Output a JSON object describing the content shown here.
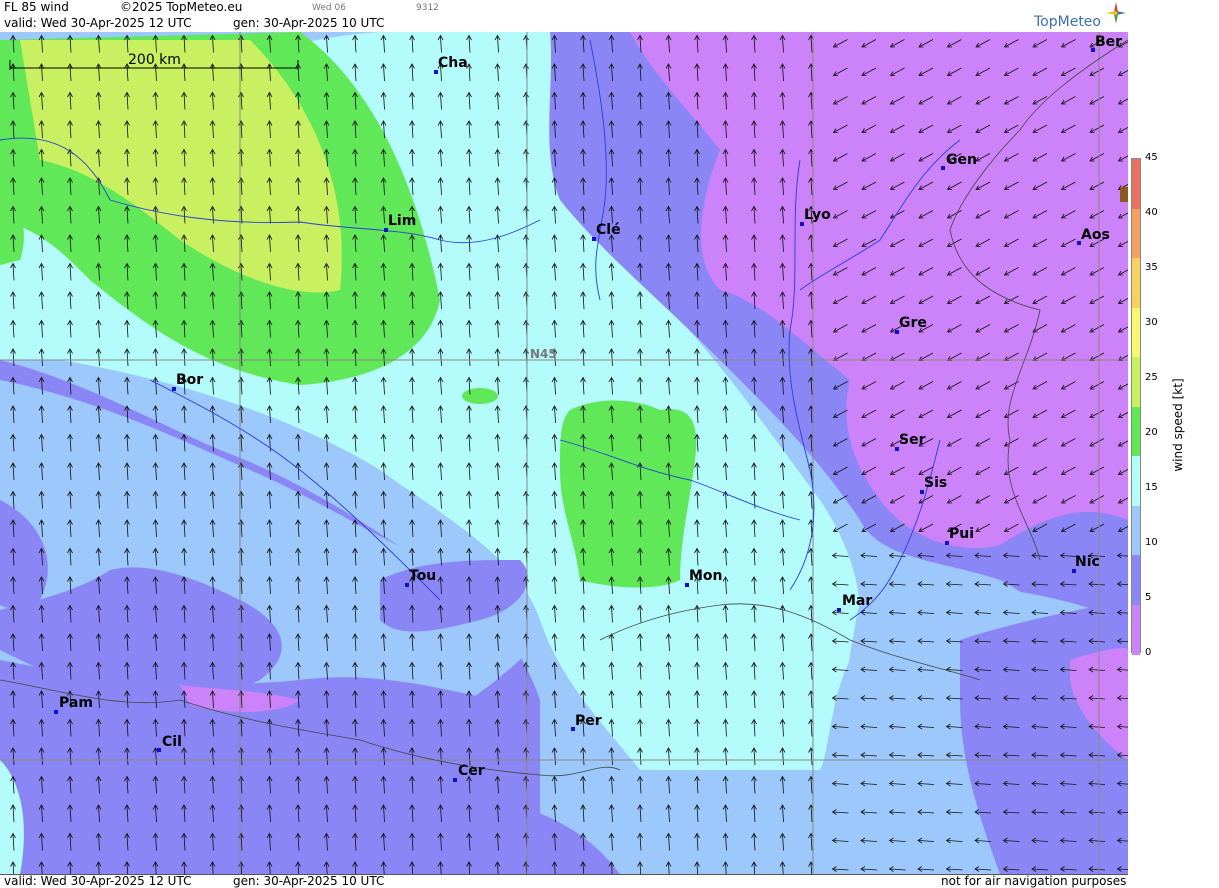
{
  "header": {
    "product": "FL 85 wind",
    "copyright": "©2025 TopMeteo.eu",
    "day_code": "Wed 06",
    "code_number": "9312",
    "valid": "valid:  Wed  30-Apr-2025  12 UTC",
    "generated": "gen: 30-Apr-2025 10 UTC",
    "logo": "TopMeteo"
  },
  "footer": {
    "valid": "valid:  Wed  30-Apr-2025  12 UTC",
    "generated": "gen: 30-Apr-2025 10 UTC",
    "disclaimer": "not for air navigation purposes"
  },
  "map": {
    "scale_label": "200 km",
    "latitude_label": "N45",
    "cities": [
      "Ber",
      "Cha",
      "Gen",
      "Lim",
      "Clé",
      "Lyo",
      "Aos",
      "Gre",
      "Bor",
      "Ser",
      "Sis",
      "Pui",
      "Nic",
      "Tou",
      "Mon",
      "Mar",
      "Pam",
      "Per",
      "Cil",
      "Cer"
    ]
  },
  "legend": {
    "title": "wind  speed  [kt]",
    "ticks": [
      "45",
      "40",
      "35",
      "30",
      "25",
      "20",
      "15",
      "10",
      "5",
      "0"
    ],
    "colors": [
      "#e87060",
      "#f5a060",
      "#f8d060",
      "#f8f870",
      "#c8f060",
      "#60e858",
      "#b4fcfc",
      "#9cc8fc",
      "#8a86f6",
      "#cc82f8"
    ],
    "accent_marker": "#8a5a20"
  }
}
